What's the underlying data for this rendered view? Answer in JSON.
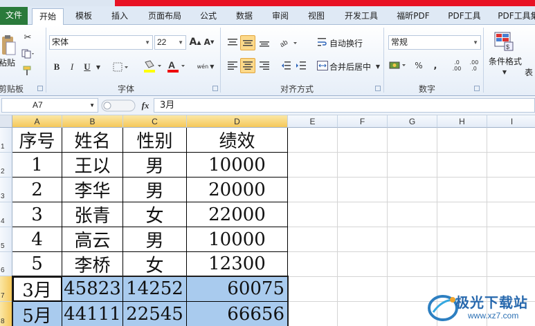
{
  "ribbon_tabs": {
    "file": "文件",
    "home": "开始",
    "template": "模板",
    "insert": "插入",
    "page_layout": "页面布局",
    "formulas": "公式",
    "data": "数据",
    "review": "审阅",
    "view": "视图",
    "developer": "开发工具",
    "foxit_pdf": "福昕PDF",
    "pdf_tools": "PDF工具",
    "pdf_toolset": "PDF工具集"
  },
  "clipboard": {
    "paste_label": "粘贴",
    "group_label": "剪贴板"
  },
  "font": {
    "name": "宋体",
    "size": "22",
    "bold": "B",
    "italic": "I",
    "underline": "U",
    "phonetic": "wén",
    "group_label": "字体"
  },
  "alignment": {
    "wrap_text": "自动换行",
    "merge_center": "合并后居中",
    "group_label": "对齐方式"
  },
  "number": {
    "format": "常规",
    "percent": "%",
    "comma": ",",
    "increase_decimal": ".0 .00",
    "decrease_decimal": ".00 .0",
    "group_label": "数字"
  },
  "styles": {
    "conditional_format": "条件格式",
    "table_format_partial": "表"
  },
  "formula_bar": {
    "cell_ref": "A7",
    "fx": "fx",
    "content": "3月"
  },
  "columns": [
    "A",
    "B",
    "C",
    "D",
    "E",
    "F",
    "G",
    "H",
    "I"
  ],
  "row_numbers": [
    "1",
    "2",
    "3",
    "4",
    "5",
    "6",
    "7",
    "8"
  ],
  "header_row": [
    "序号",
    "姓名",
    "性别",
    "绩效"
  ],
  "data_rows": [
    [
      "1",
      "王以",
      "男",
      "10000"
    ],
    [
      "2",
      "李华",
      "男",
      "20000"
    ],
    [
      "3",
      "张青",
      "女",
      "22000"
    ],
    [
      "4",
      "高云",
      "男",
      "10000"
    ],
    [
      "5",
      "李桥",
      "女",
      "12300"
    ]
  ],
  "selected_rows": [
    [
      "3月",
      "45823",
      "14252",
      "60075"
    ],
    [
      "5月",
      "44111",
      "22545",
      "66656"
    ]
  ],
  "watermark": {
    "text": "极光下载站",
    "url": "www.xz7.com"
  },
  "colors": {
    "file_tab": "#2a7a3b",
    "selection_fill": "#a9cbee",
    "header_highlight": "#f5c85a",
    "top_bar_red": "#e81123"
  }
}
